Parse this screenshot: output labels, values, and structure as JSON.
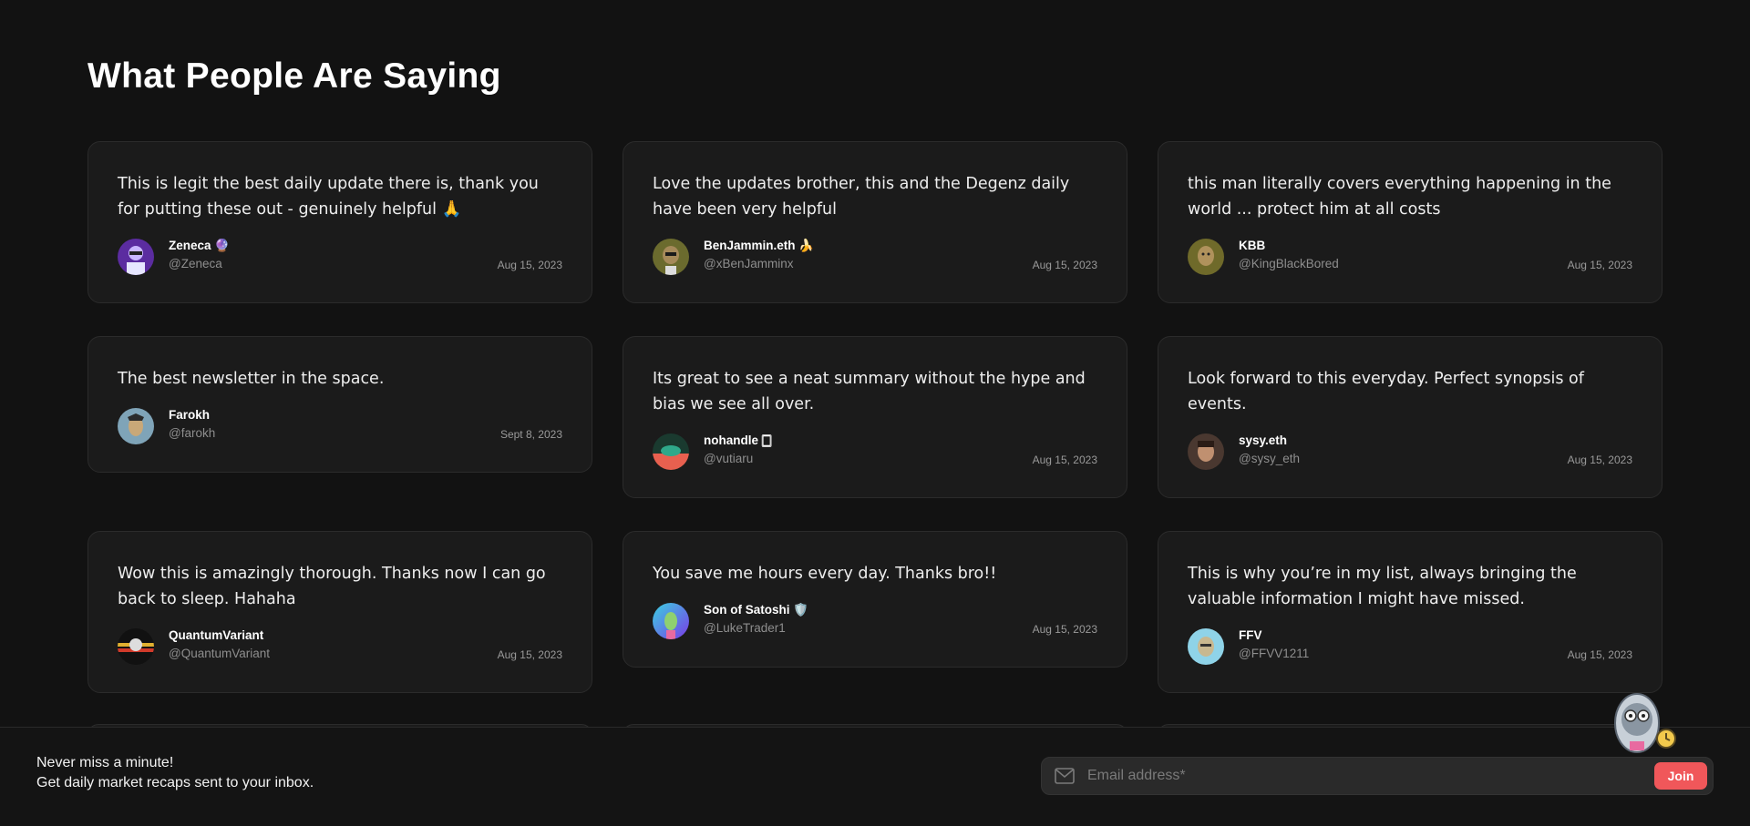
{
  "section": {
    "title": "What People Are Saying"
  },
  "testimonials": [
    {
      "quote": "This is legit the best daily update there is, thank you for putting these out - genuinely helpful 🙏",
      "name": "Zeneca 🔮",
      "handle": "@Zeneca",
      "date": "Aug 15, 2023",
      "avatar_color": "#5b2ca0"
    },
    {
      "quote": "Love the updates brother, this and the Degenz daily have been very helpful",
      "name": "BenJammin.eth 🍌",
      "handle": "@xBenJamminx",
      "date": "Aug 15, 2023",
      "avatar_color": "#6b6b2e"
    },
    {
      "quote": "this man literally covers everything happening in the world ... protect him at all costs",
      "name": "KBB",
      "handle": "@KingBlackBored",
      "date": "Aug 15, 2023",
      "avatar_color": "#6f6a2a"
    },
    {
      "quote": "The best newsletter in the space.",
      "name": "Farokh",
      "handle": "@farokh",
      "date": "Sept 8, 2023",
      "avatar_color": "#7fa4b8"
    },
    {
      "quote": "Its great to see a neat summary without the hype and bias we see all over.",
      "name": "nohandle 🀆",
      "handle": "@vutiaru",
      "date": "Aug 15, 2023",
      "avatar_color": "#1a3a2f"
    },
    {
      "quote": "Look forward to this everyday. Perfect synopsis of events.",
      "name": "sysy.eth",
      "handle": "@sysy_eth",
      "date": "Aug 15, 2023",
      "avatar_color": "#4a3830"
    },
    {
      "quote": "Wow this is amazingly thorough. Thanks now I can go back to sleep. Hahaha",
      "name": "QuantumVariant",
      "handle": "@QuantumVariant",
      "date": "Aug 15, 2023",
      "avatar_color": "#111111"
    },
    {
      "quote": "You save me hours every day. Thanks bro!!",
      "name": "Son of Satoshi 🛡️",
      "handle": "@LukeTrader1",
      "date": "Aug 15, 2023",
      "avatar_color": "#4a6de0"
    },
    {
      "quote": "This is why you’re in my list, always bringing the valuable information I might have missed.",
      "name": "FFV",
      "handle": "@FFVV1211",
      "date": "Aug 15, 2023",
      "avatar_color": "#8fd3e8"
    }
  ],
  "footer": {
    "line1": "Never miss a minute!",
    "line2": "Get daily market recaps sent to your inbox.",
    "email_placeholder": "Email address*",
    "join_label": "Join",
    "accent": "#f0575a"
  }
}
